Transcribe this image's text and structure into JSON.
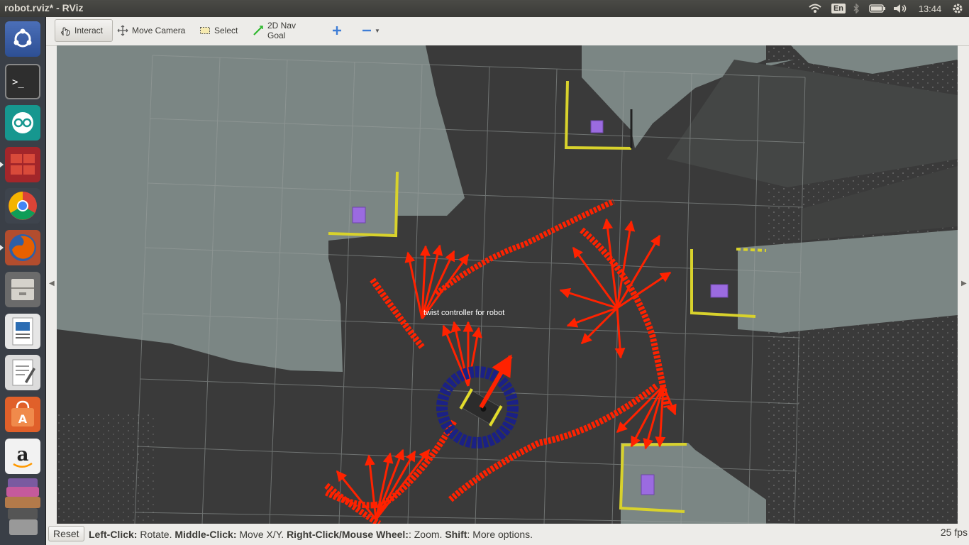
{
  "window": {
    "title": "robot.rviz* - RViz"
  },
  "topbar": {
    "language": "En",
    "clock": "13:44",
    "icons": [
      "wifi-icon",
      "bluetooth-icon",
      "battery-icon",
      "volume-icon",
      "gear-icon"
    ]
  },
  "launcher": {
    "items": [
      "ubuntu-dash",
      "terminal",
      "arduino",
      "workspace-switcher",
      "chrome",
      "firefox",
      "file-manager",
      "libreoffice-impress",
      "text-editor",
      "software-center",
      "amazon",
      "app-stack"
    ]
  },
  "toolbar": {
    "interact": "Interact",
    "move_camera": "Move Camera",
    "select": "Select",
    "nav_goal": "2D Nav Goal"
  },
  "viewport": {
    "marker_text": "twist  controller  for  robot",
    "colors": {
      "unknown": "#3a3a3a",
      "free": "#7a8683",
      "wall": "#d7d12a",
      "box": "#9b6be0",
      "arrow": "#ff2200",
      "ring": "#1a1f8a"
    }
  },
  "status": {
    "reset": "Reset",
    "hint_1_key": "Left-Click:",
    "hint_1_val": " Rotate. ",
    "hint_2_key": "Middle-Click:",
    "hint_2_val": " Move X/Y. ",
    "hint_3_key": "Right-Click/Mouse Wheel:",
    "hint_3_val": ": Zoom. ",
    "hint_4_key": "Shift",
    "hint_4_val": ": More options.",
    "fps": "25 fps"
  }
}
